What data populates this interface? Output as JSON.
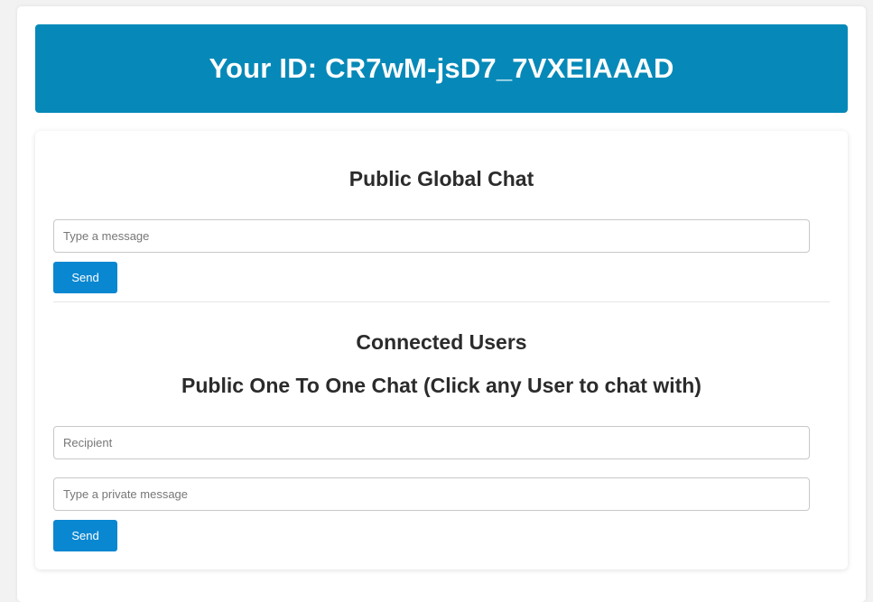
{
  "banner": {
    "title": "Your ID: CR7wM-jsD7_7VXEIAAAD"
  },
  "global_chat": {
    "heading": "Public Global Chat",
    "message_placeholder": "Type a message",
    "send_label": "Send"
  },
  "connected_users": {
    "heading": "Connected Users"
  },
  "private_chat": {
    "heading": "Public One To One Chat (Click any User to chat with)",
    "recipient_placeholder": "Recipient",
    "message_placeholder": "Type a private message",
    "send_label": "Send"
  },
  "colors": {
    "banner_bg": "#0689b8",
    "button_bg": "#0a87d1"
  }
}
